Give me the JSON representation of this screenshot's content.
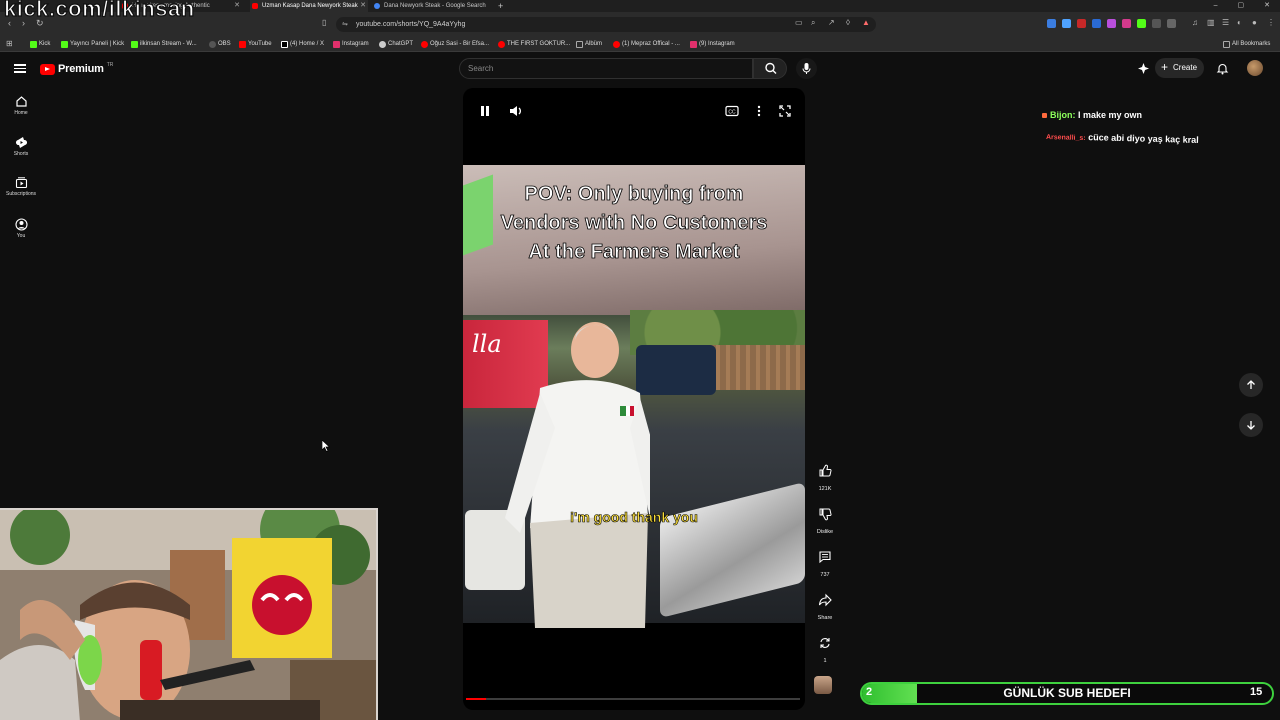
{
  "browser": {
    "tabs": [
      {
        "label": "kick.com/ilkinsan",
        "color": "#53fc18"
      },
      {
        "label": "He makes amazing Authentic",
        "color": "#ff0000"
      },
      {
        "label": "Uzman Kasap Dana Newyork Steak",
        "color": "#ff0000"
      },
      {
        "label": "Dana Newyork Steak - Google Search",
        "color": "#4285f4"
      }
    ],
    "url": "youtube.com/shorts/YQ_9A4aYyhg",
    "bookmarks": [
      {
        "label": "Kick",
        "color": "#53fc18"
      },
      {
        "label": "Yayıncı Paneli | Kick",
        "color": "#53fc18"
      },
      {
        "label": "ilkinsan Stream - W...",
        "color": "#53fc18"
      },
      {
        "label": "OBS",
        "color": "#555555"
      },
      {
        "label": "YouTube",
        "color": "#ff0000"
      },
      {
        "label": "(4) Home / X",
        "color": "#ffffff"
      },
      {
        "label": "Instagram",
        "color": "#e1306c"
      },
      {
        "label": "ChatGPT",
        "color": "#cccccc"
      },
      {
        "label": "Oğuz Sasi - Bir Efsa...",
        "color": "#ff0000"
      },
      {
        "label": "THE FIRST GOKTUR...",
        "color": "#ff0000"
      },
      {
        "label": "Albüm",
        "color": "#888888"
      },
      {
        "label": "(1) Mepraz Offical - ...",
        "color": "#ff0000"
      },
      {
        "label": "(9) Instagram",
        "color": "#e1306c"
      }
    ],
    "all_bookmarks": "All Bookmarks"
  },
  "watermark": "kick.com/ilkinsan",
  "youtube": {
    "logo_text": "Premium",
    "logo_sup": "TR",
    "search_placeholder": "Search",
    "create_label": "Create",
    "nav": [
      {
        "label": "Home",
        "icon": "home-icon"
      },
      {
        "label": "Shorts",
        "icon": "shorts-icon"
      },
      {
        "label": "Subscriptions",
        "icon": "subscriptions-icon"
      },
      {
        "label": "You",
        "icon": "you-icon"
      }
    ]
  },
  "video": {
    "overlay_lines": [
      "POV: Only buying from",
      "Vendors with No Customers",
      "At the Farmers Market"
    ],
    "banner_text": "lla",
    "subtitle": "i'm good thank you",
    "progress_fraction": 0.06
  },
  "actions": {
    "likes": "121K",
    "dislike": "Dislike",
    "comments": "737",
    "share": "Share",
    "remix": "1"
  },
  "chat": [
    {
      "user": "Bijon:",
      "message": "I make my own",
      "user_color": "#8dff5c"
    },
    {
      "user": "Arsenalli_s:",
      "message": "cüce abi diyo yaş kaç kral",
      "user_color": "#ff4d4d"
    }
  ],
  "sub_goal": {
    "current": "2",
    "label": "GÜNLÜK SUB HEDEFI",
    "target": "15",
    "fraction": 0.1333
  }
}
